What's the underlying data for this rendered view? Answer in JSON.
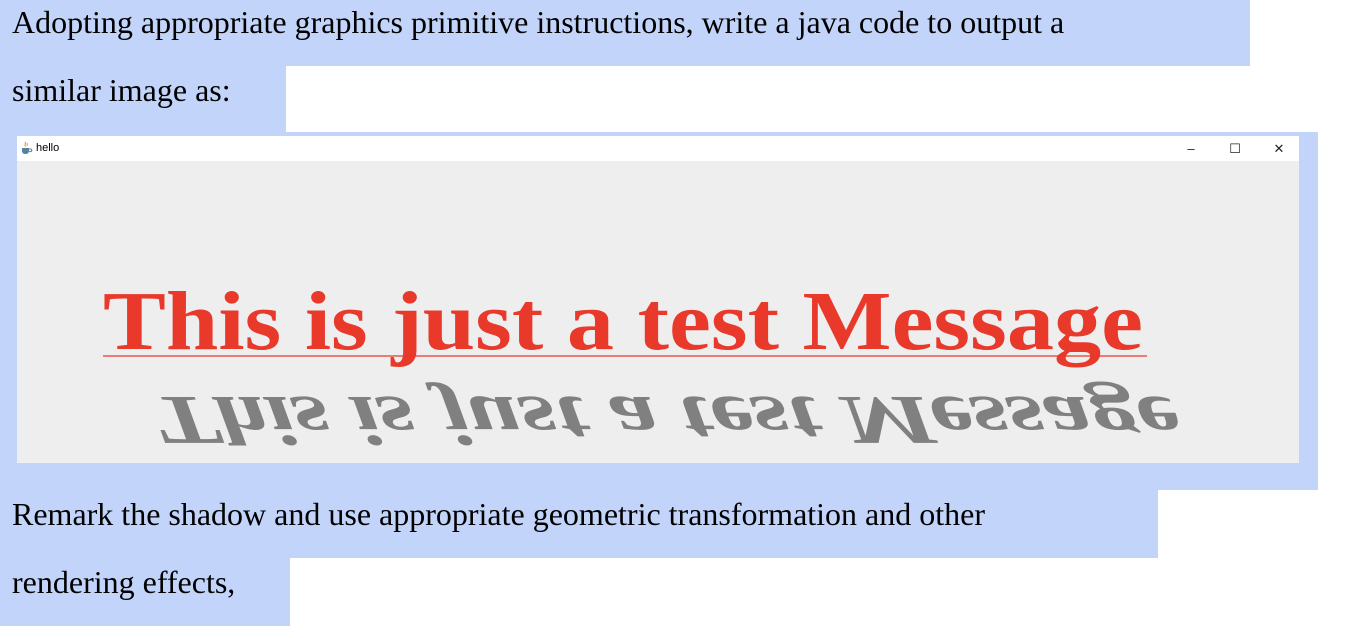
{
  "paragraph_top": {
    "line1": "Adopting appropriate graphics primitive instructions, write a java code to output a",
    "line2": "similar image as:"
  },
  "window": {
    "title": "hello",
    "minimize_glyph": "–",
    "maximize_glyph": "☐",
    "close_glyph": "✕"
  },
  "canvas": {
    "message": "This is just a test Message",
    "message_color": "#e8392b",
    "shadow_color": "#808080",
    "underline_color": "#e8392b",
    "background": "#eeeeee"
  },
  "paragraph_bottom": {
    "line1": "Remark the shadow and use appropriate geometric transformation and other",
    "line2": "rendering effects,"
  },
  "colors": {
    "selection": "#c2d4f9"
  }
}
